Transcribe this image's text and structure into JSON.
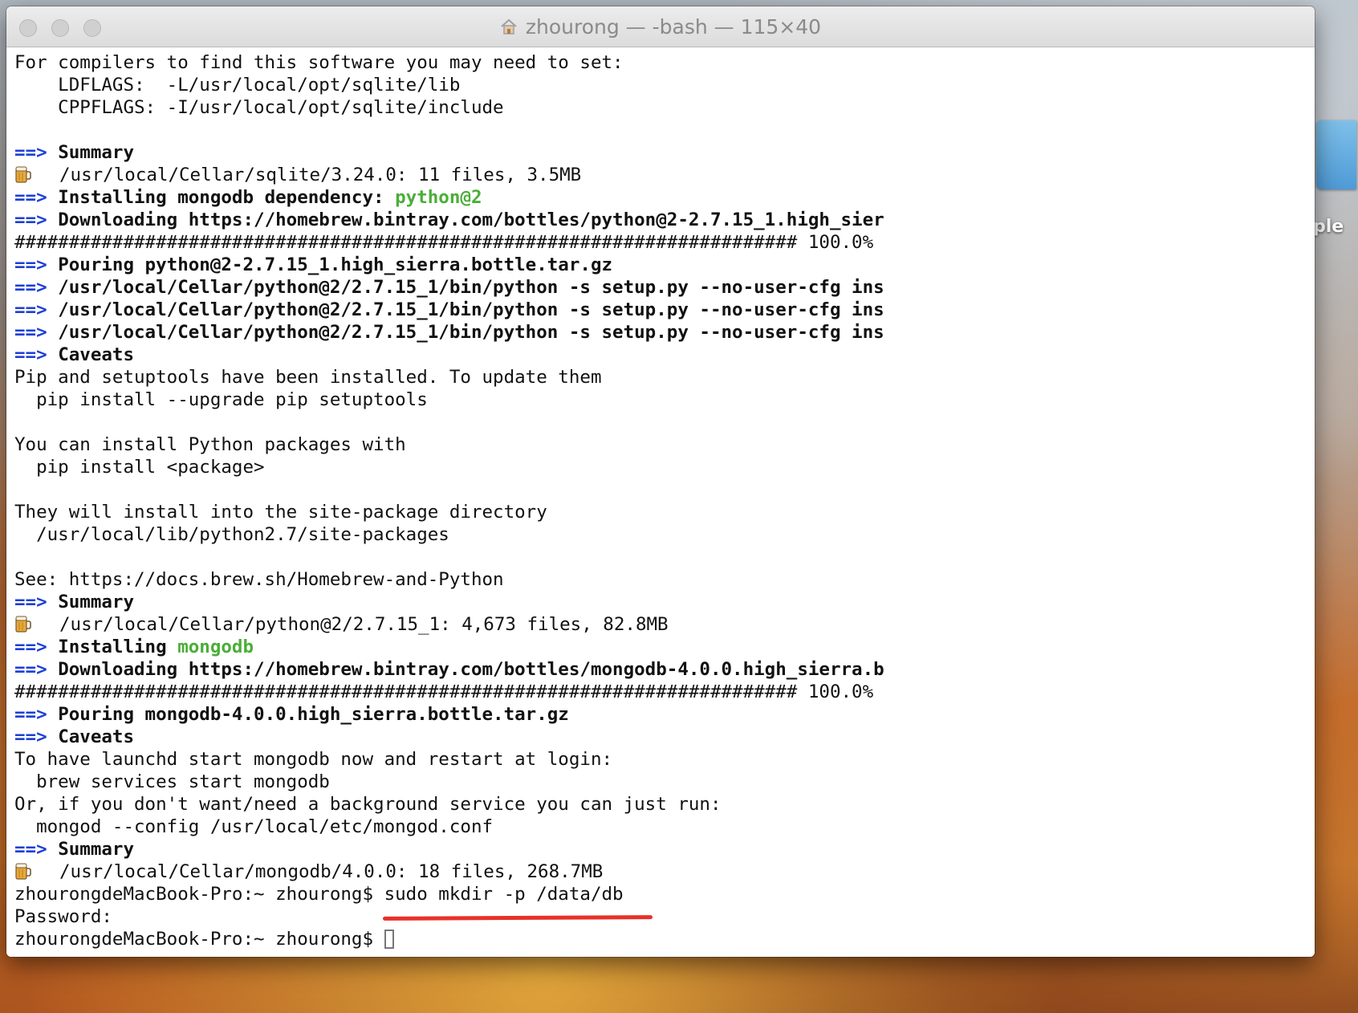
{
  "desktop": {
    "label": "ple"
  },
  "window": {
    "title": "zhourong — -bash — 115×40"
  },
  "terminal": {
    "lines": [
      {
        "kind": "text",
        "text": "For compilers to find this software you may need to set:"
      },
      {
        "kind": "text",
        "text": "    LDFLAGS:  -L/usr/local/opt/sqlite/lib"
      },
      {
        "kind": "text",
        "text": "    CPPFLAGS: -I/usr/local/opt/sqlite/include"
      },
      {
        "kind": "blank",
        "text": ""
      },
      {
        "kind": "arrow",
        "arrow": "==>",
        "text": "Summary"
      },
      {
        "kind": "beer",
        "text": "/usr/local/Cellar/sqlite/3.24.0: 11 files, 3.5MB"
      },
      {
        "kind": "arrow",
        "arrow": "==>",
        "text": "Installing mongodb dependency: ",
        "highlight": "python@2"
      },
      {
        "kind": "arrow",
        "arrow": "==>",
        "text": "Downloading https://homebrew.bintray.com/bottles/python@2-2.7.15_1.high_sier"
      },
      {
        "kind": "text",
        "text": "######################################################################## 100.0%"
      },
      {
        "kind": "arrow",
        "arrow": "==>",
        "text": "Pouring python@2-2.7.15_1.high_sierra.bottle.tar.gz"
      },
      {
        "kind": "arrow",
        "arrow": "==>",
        "text": "/usr/local/Cellar/python@2/2.7.15_1/bin/python -s setup.py --no-user-cfg ins"
      },
      {
        "kind": "arrow",
        "arrow": "==>",
        "text": "/usr/local/Cellar/python@2/2.7.15_1/bin/python -s setup.py --no-user-cfg ins"
      },
      {
        "kind": "arrow",
        "arrow": "==>",
        "text": "/usr/local/Cellar/python@2/2.7.15_1/bin/python -s setup.py --no-user-cfg ins"
      },
      {
        "kind": "arrow",
        "arrow": "==>",
        "text": "Caveats"
      },
      {
        "kind": "text",
        "text": "Pip and setuptools have been installed. To update them"
      },
      {
        "kind": "text",
        "text": "  pip install --upgrade pip setuptools"
      },
      {
        "kind": "blank",
        "text": ""
      },
      {
        "kind": "text",
        "text": "You can install Python packages with"
      },
      {
        "kind": "text",
        "text": "  pip install <package>"
      },
      {
        "kind": "blank",
        "text": ""
      },
      {
        "kind": "text",
        "text": "They will install into the site-package directory"
      },
      {
        "kind": "text",
        "text": "  /usr/local/lib/python2.7/site-packages"
      },
      {
        "kind": "blank",
        "text": ""
      },
      {
        "kind": "text",
        "text": "See: https://docs.brew.sh/Homebrew-and-Python"
      },
      {
        "kind": "arrow",
        "arrow": "==>",
        "text": "Summary"
      },
      {
        "kind": "beer",
        "text": "/usr/local/Cellar/python@2/2.7.15_1: 4,673 files, 82.8MB"
      },
      {
        "kind": "arrow",
        "arrow": "==>",
        "text": "Installing ",
        "highlight": "mongodb"
      },
      {
        "kind": "arrow",
        "arrow": "==>",
        "text": "Downloading https://homebrew.bintray.com/bottles/mongodb-4.0.0.high_sierra.b"
      },
      {
        "kind": "text",
        "text": "######################################################################## 100.0%"
      },
      {
        "kind": "arrow",
        "arrow": "==>",
        "text": "Pouring mongodb-4.0.0.high_sierra.bottle.tar.gz"
      },
      {
        "kind": "arrow",
        "arrow": "==>",
        "text": "Caveats"
      },
      {
        "kind": "text",
        "text": "To have launchd start mongodb now and restart at login:"
      },
      {
        "kind": "text",
        "text": "  brew services start mongodb"
      },
      {
        "kind": "text",
        "text": "Or, if you don't want/need a background service you can just run:"
      },
      {
        "kind": "text",
        "text": "  mongod --config /usr/local/etc/mongod.conf"
      },
      {
        "kind": "arrow",
        "arrow": "==>",
        "text": "Summary"
      },
      {
        "kind": "beer",
        "text": "/usr/local/Cellar/mongodb/4.0.0: 18 files, 268.7MB"
      },
      {
        "kind": "text",
        "text": "zhourongdeMacBook-Pro:~ zhourong$ sudo mkdir -p /data/db"
      },
      {
        "kind": "text",
        "text": "Password:"
      },
      {
        "kind": "prompt",
        "text": "zhourongdeMacBook-Pro:~ zhourong$ "
      }
    ]
  },
  "colors": {
    "arrow": "#1c3fd6",
    "highlight": "#4aae38",
    "annotation": "#e8312a"
  }
}
